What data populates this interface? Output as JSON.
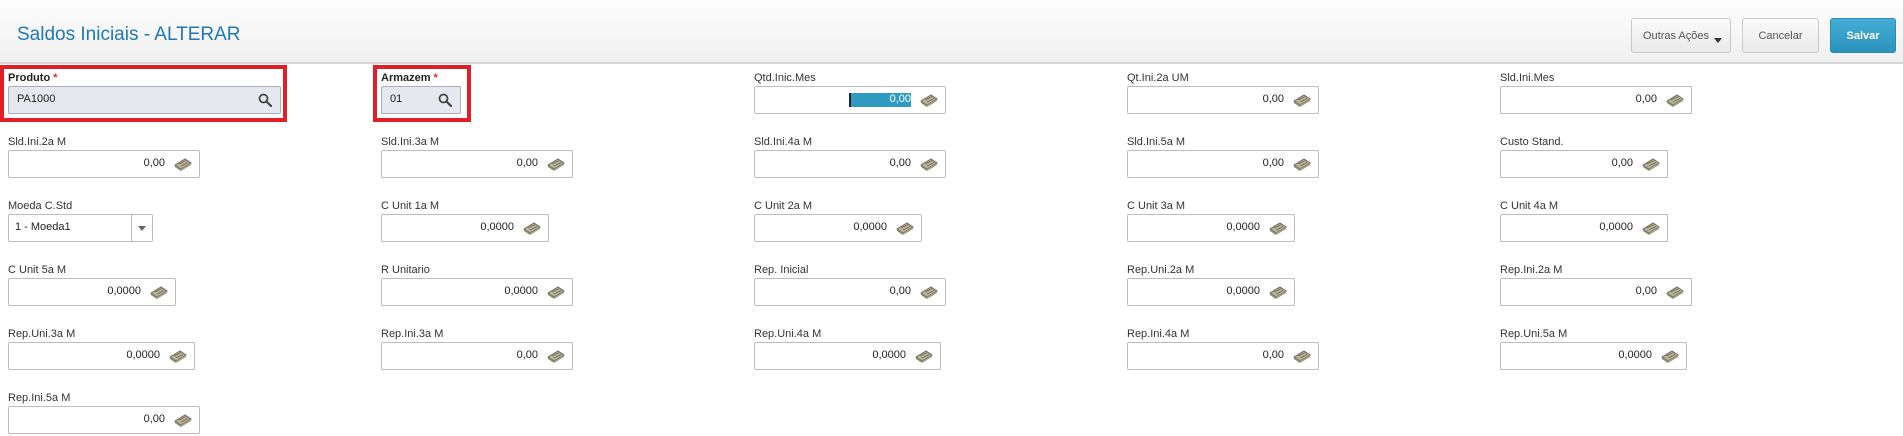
{
  "header": {
    "title": "Saldos Iniciais - ALTERAR",
    "buttons": {
      "outras": "Outras Ações",
      "cancelar": "Cancelar",
      "salvar": "Salvar"
    }
  },
  "fields": [
    {
      "label": "Produto",
      "value": "PA1000",
      "required": true,
      "type": "lookup"
    },
    {
      "label": "Armazem",
      "value": "01",
      "required": true,
      "type": "lookup"
    },
    {
      "label": "Qtd.Inic.Mes",
      "value": "0,00",
      "type": "number",
      "focused": true
    },
    {
      "label": "Qt.Ini.2a UM",
      "value": "0,00",
      "type": "number"
    },
    {
      "label": "Sld.Ini.Mes",
      "value": "0,00",
      "type": "number"
    },
    {
      "label": "Sld.Ini.2a M",
      "value": "0,00",
      "type": "number"
    },
    {
      "label": "Sld.Ini.3a M",
      "value": "0,00",
      "type": "number"
    },
    {
      "label": "Sld.Ini.4a M",
      "value": "0,00",
      "type": "number"
    },
    {
      "label": "Sld.Ini.5a M",
      "value": "0,00",
      "type": "number"
    },
    {
      "label": "Custo Stand.",
      "value": "0,00",
      "type": "number"
    },
    {
      "label": "Moeda C.Std",
      "value": "1 - Moeda1",
      "type": "select"
    },
    {
      "label": "C Unit 1a M",
      "value": "0,0000",
      "type": "number"
    },
    {
      "label": "C Unit 2a M",
      "value": "0,0000",
      "type": "number"
    },
    {
      "label": "C Unit 3a M",
      "value": "0,0000",
      "type": "number"
    },
    {
      "label": "C Unit 4a M",
      "value": "0,0000",
      "type": "number"
    },
    {
      "label": "C Unit 5a M",
      "value": "0,0000",
      "type": "number"
    },
    {
      "label": "R Unitario",
      "value": "0,0000",
      "type": "number"
    },
    {
      "label": "Rep. Inicial",
      "value": "0,00",
      "type": "number"
    },
    {
      "label": "Rep.Uni.2a M",
      "value": "0,0000",
      "type": "number"
    },
    {
      "label": "Rep.Ini.2a M",
      "value": "0,00",
      "type": "number"
    },
    {
      "label": "Rep.Uni.3a M",
      "value": "0,0000",
      "type": "number"
    },
    {
      "label": "Rep.Ini.3a M",
      "value": "0,00",
      "type": "number"
    },
    {
      "label": "Rep.Uni.4a M",
      "value": "0,0000",
      "type": "number"
    },
    {
      "label": "Rep.Ini.4a M",
      "value": "0,00",
      "type": "number"
    },
    {
      "label": "Rep.Uni.5a M",
      "value": "0,0000",
      "type": "number"
    },
    {
      "label": "Rep.Ini.5a M",
      "value": "0,00",
      "type": "number"
    }
  ],
  "icons": {
    "lookup": "search-icon",
    "number": "calculator-icon",
    "select": "chevron-down-icon"
  },
  "colors": {
    "accent": "#2b92bd",
    "title": "#1f77b4",
    "highlight_box": "#e01f26",
    "required_star": "#e0262b"
  }
}
